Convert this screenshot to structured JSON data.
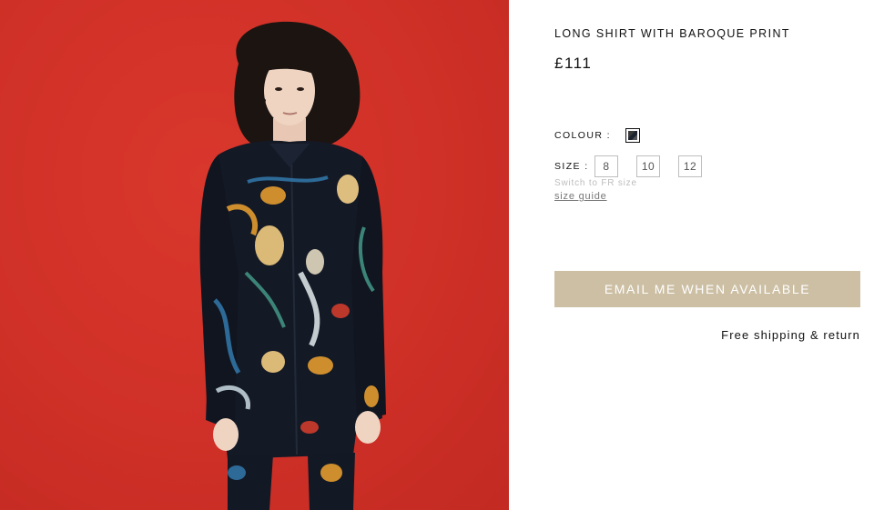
{
  "product": {
    "title": "LONG SHIRT WITH BAROQUE PRINT",
    "price": "£111",
    "image_alt": "Model wearing long shirt with baroque print on red background"
  },
  "colour": {
    "label": "COLOUR :",
    "selected_swatch": "dark-baroque-print"
  },
  "size": {
    "label": "SIZE :",
    "options": [
      "8",
      "10",
      "12"
    ],
    "switch_label": "Switch to FR size",
    "guide_label": "size guide"
  },
  "cta": {
    "label": "EMAIL ME WHEN AVAILABLE",
    "color": "#ccbfa4"
  },
  "shipping": {
    "text": "Free shipping & return"
  },
  "colors": {
    "photo_background": "#d1322a",
    "shirt": "#141926"
  }
}
